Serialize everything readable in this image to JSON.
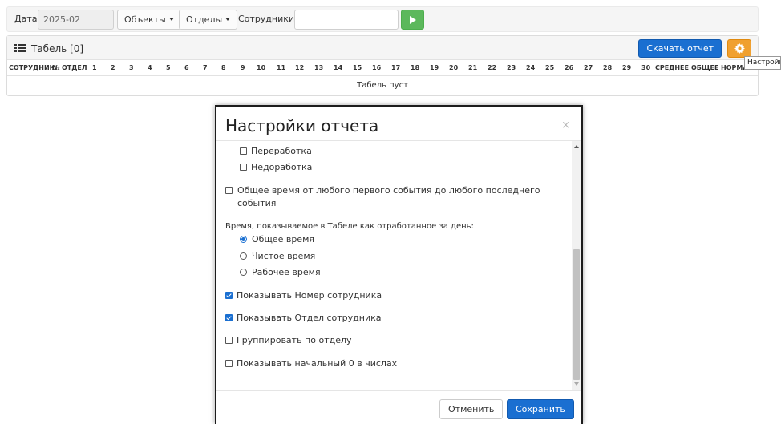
{
  "filters": {
    "date_label": "Дата",
    "date_value": "2025-02",
    "objects_label": "Объекты",
    "departments_label": "Отделы",
    "employees_label": "Сотрудники",
    "employees_value": ""
  },
  "report": {
    "title": "Табель [0]",
    "download_label": "Скачать отчет",
    "settings_tooltip": "Настройки",
    "columns": {
      "employee": "СОТРУДНИК",
      "number": "№",
      "department": "ОТДЕЛ",
      "days": [
        "1",
        "2",
        "3",
        "4",
        "5",
        "6",
        "7",
        "8",
        "9",
        "10",
        "11",
        "12",
        "13",
        "14",
        "15",
        "16",
        "17",
        "18",
        "19",
        "20",
        "21",
        "22",
        "23",
        "24",
        "25",
        "26",
        "27",
        "28",
        "29",
        "30"
      ],
      "average": "СРЕДНЕЕ",
      "total": "ОБЩЕЕ",
      "norm": "НОРМА"
    },
    "empty_text": "Табель пуст"
  },
  "modal": {
    "title": "Настройки отчета",
    "close": "×",
    "options": {
      "overtime": {
        "label": "Переработка",
        "checked": false
      },
      "undertime": {
        "label": "Недоработка",
        "checked": false
      },
      "total_first_last": {
        "label": "Общее время от любого первого события до любого последнего события",
        "checked": false
      },
      "time_mode_label": "Время, показываемое в Табеле как отработанное за день:",
      "time_modes": [
        {
          "label": "Общее время",
          "selected": true
        },
        {
          "label": "Чистое время",
          "selected": false
        },
        {
          "label": "Рабочее время",
          "selected": false
        }
      ],
      "show_number": {
        "label": "Показывать Номер сотрудника",
        "checked": true
      },
      "show_department": {
        "label": "Показывать Отдел сотрудника",
        "checked": true
      },
      "group_by_department": {
        "label": "Группировать по отделу",
        "checked": false
      },
      "leading_zero": {
        "label": "Показывать начальный 0 в числах",
        "checked": false
      }
    },
    "cancel_label": "Отменить",
    "save_label": "Сохранить"
  },
  "colors": {
    "primary": "#1a6fd1",
    "success": "#5cb85c",
    "warning": "#f0a030"
  }
}
